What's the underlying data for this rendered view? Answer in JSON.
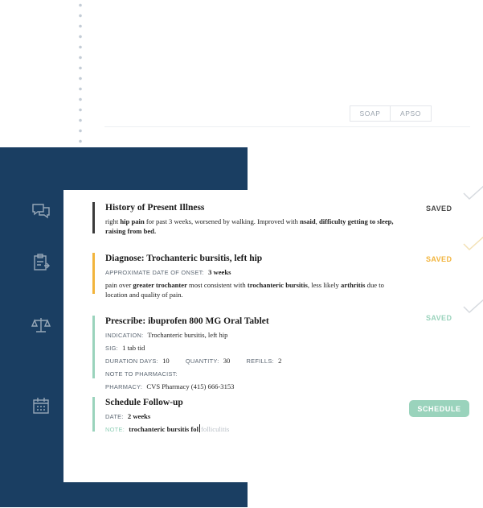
{
  "colors": {
    "navy": "#1a3e62",
    "hpi_bar": "#3a3a3a",
    "diagnose_bar": "#f2b43c",
    "prescribe_bar": "#9ad3bc",
    "schedule_bar": "#9ad3bc",
    "status_gray": "#4a4a4a",
    "status_yellow": "#f2b43c",
    "status_green": "#9ad3bc"
  },
  "toggle": {
    "soap": "SOAP",
    "apso": "APSO"
  },
  "sidebar_icons": [
    "chat-icon",
    "clipboard-icon",
    "scale-icon",
    "calendar-icon"
  ],
  "hpi": {
    "title": "History of Present Illness",
    "status": "SAVED",
    "text": {
      "t1": "right ",
      "b1": "hip pain",
      "t2": " for past 3 weeks, worsened by walking. Improved with ",
      "b2": "nsaid",
      "t3": ", ",
      "b3": "difficulty getting to sleep, raising from bed."
    }
  },
  "diagnose": {
    "title_prefix": "Diagnose",
    "title_value": ": Trochanteric bursitis, left hip",
    "status": "SAVED",
    "onset_label": "APPROXIMATE DATE OF ONSET:",
    "onset_value": "3 weeks",
    "text": {
      "t1": "pain over ",
      "b1": "greater trochanter",
      "t2": " most consistent with ",
      "b2": "trochanteric bursitis",
      "t3": ", less likely ",
      "b3": "arthritis",
      "t4": " due to location and quality of pain."
    }
  },
  "prescribe": {
    "title_prefix": "Prescribe",
    "title_value": ": ibuprofen 800 MG Oral Tablet",
    "status": "SAVED",
    "indication_label": "INDICATION:",
    "indication_value": "Trochanteric bursitis, left hip",
    "sig_label": "SIG:",
    "sig_value": "1 tab tid",
    "duration_label": "DURATION DAYS:",
    "duration_value": "10",
    "quantity_label": "QUANTITY:",
    "quantity_value": "30",
    "refills_label": "REFILLS:",
    "refills_value": "2",
    "note_label": "NOTE TO PHARMACIST:",
    "pharmacy_label": "PHARMACY:",
    "pharmacy_value": "CVS Pharmacy (415) 666-3153"
  },
  "schedule": {
    "title": "Schedule Follow-up",
    "button": "SCHEDULE",
    "date_label": "DATE:",
    "date_value": "2 weeks",
    "note_label": "NOTE:",
    "note_typed": "trochanteric bursitis fol",
    "note_suggestion": "folliculitis"
  }
}
